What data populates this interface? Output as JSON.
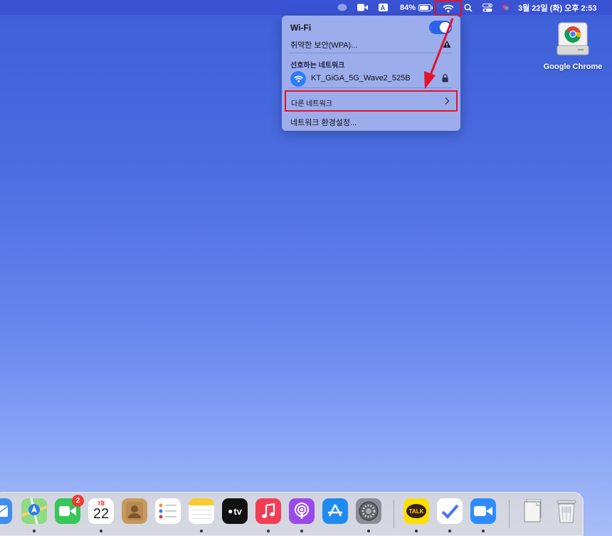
{
  "menubar": {
    "battery_percent": "84%",
    "input_label": "A",
    "clock": "3월 22일 (화) 오후  2:53"
  },
  "wifi_menu": {
    "title": "Wi-Fi",
    "toggle_on": true,
    "weak_security": "취약한 보안(WPA)...",
    "preferred_header": "선호하는 네트워크",
    "network_name": "KT_GiGA_5G_Wave2_525B",
    "other_networks": "다른 네트워크",
    "network_prefs": "네트워크 환경설정..."
  },
  "desktop": {
    "chrome_label": "Google Chrome"
  },
  "dock": {
    "facetime_badge": "2",
    "calendar_month": "3월",
    "calendar_day": "22",
    "appletv_label": "tv",
    "kakaotalk_label": "TALK",
    "apps": [
      "mail-icon",
      "maps-icon",
      "facetime-icon",
      "calendar-icon",
      "contacts-icon",
      "reminders-icon",
      "notes-icon",
      "appletv-icon",
      "music-icon",
      "podcasts-icon",
      "appstore-icon",
      "system-preferences-icon",
      "kakaotalk-icon",
      "ticktick-icon",
      "zoom-icon",
      "document-icon",
      "trash-icon"
    ]
  },
  "colors": {
    "highlight": "#e8102a",
    "accent": "#2d63e8"
  }
}
